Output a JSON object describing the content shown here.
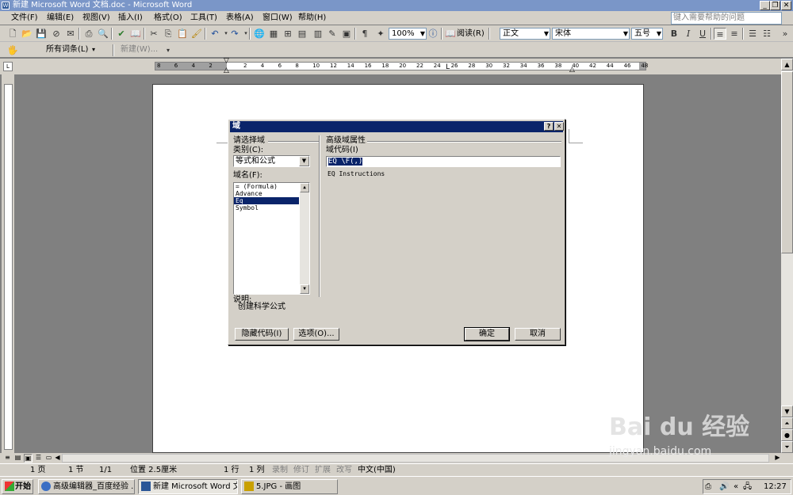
{
  "window": {
    "title": "新建 Microsoft Word 文档.doc - Microsoft Word",
    "help_placeholder": "键入需要帮助的问题"
  },
  "menu": [
    "文件(F)",
    "编辑(E)",
    "视图(V)",
    "插入(I)",
    "格式(O)",
    "工具(T)",
    "表格(A)",
    "窗口(W)",
    "帮助(H)"
  ],
  "toolbar": {
    "zoom": "100%",
    "read_label": "阅读(R)",
    "style": "正文",
    "font": "宋体",
    "size": "五号"
  },
  "toolbar2": {
    "entries_label": "所有词条(L)",
    "new_label": "新建(W)..."
  },
  "ruler": {
    "ticks": [
      "8",
      "6",
      "4",
      "2",
      "",
      "2",
      "4",
      "6",
      "8",
      "10",
      "12",
      "14",
      "16",
      "18",
      "20",
      "22",
      "24",
      "26",
      "28",
      "30",
      "32",
      "34",
      "36",
      "38",
      "40",
      "42",
      "44",
      "46",
      "48"
    ]
  },
  "dialog": {
    "title": "域",
    "select_group": "请选择域",
    "category_label": "类别(C):",
    "category_value": "等式和公式",
    "field_names_label": "域名(F):",
    "field_names": [
      "= (Formula)",
      "Advance",
      "Eq",
      "Symbol"
    ],
    "selected_field": "Eq",
    "advanced_group": "高级域属性",
    "field_code_label": "域代码(I)",
    "field_code_value": "EQ \\F(,)",
    "instructions": "EQ Instructions",
    "desc_label": "说明:",
    "desc_text": "创建科学公式",
    "hide_codes_btn": "隐藏代码(I)",
    "options_btn": "选项(O)...",
    "ok_btn": "确定",
    "cancel_btn": "取消"
  },
  "status": {
    "page": "1 页",
    "section": "1 节",
    "pages": "1/1",
    "position": "位置 2.5厘米",
    "line": "1 行",
    "col": "1 列",
    "rec": "录制",
    "trk": "修订",
    "ext": "扩展",
    "ovr": "改写",
    "lang": "中文(中国)"
  },
  "taskbar": {
    "start": "开始",
    "tasks": [
      "高级编辑器_百度经验 ...",
      "新建 Microsoft Word 文...",
      "5.JPG - 画图"
    ],
    "clock": "12:27"
  },
  "watermark": {
    "brand": "Bai du 经验",
    "url": "jingyan.baidu.com"
  }
}
